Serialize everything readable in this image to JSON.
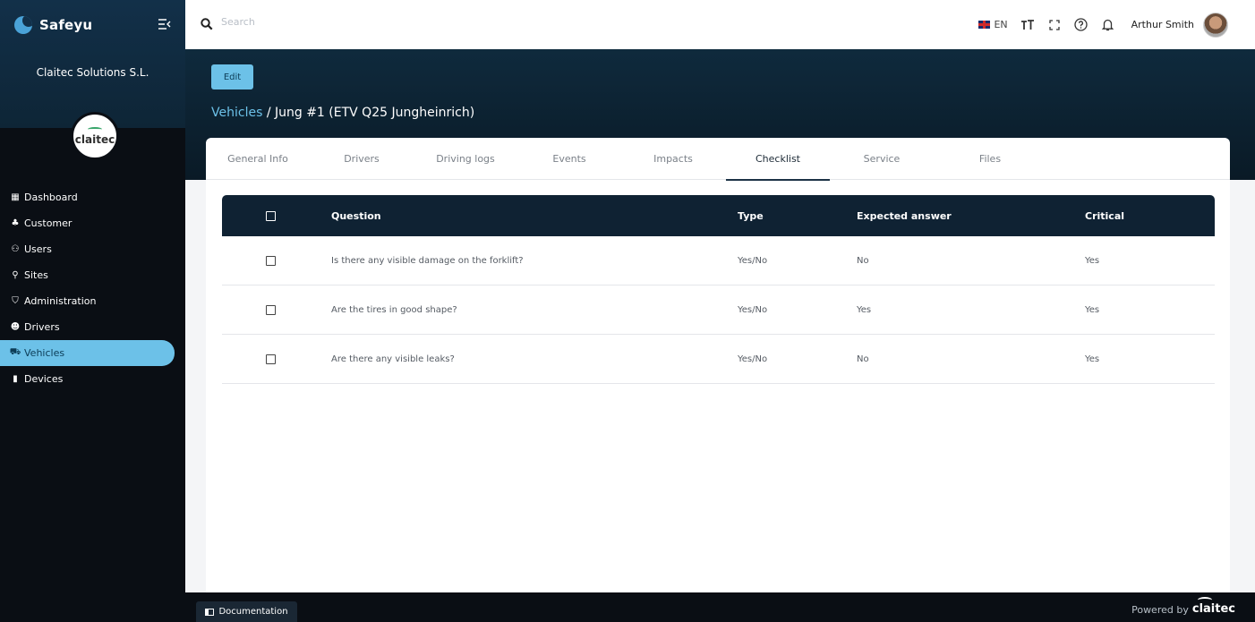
{
  "app": {
    "name": "Safeyu",
    "company": "Claitec Solutions S.L.",
    "org_logo_text": "claitec"
  },
  "nav": {
    "items": [
      {
        "label": "Dashboard",
        "icon": "dashboard-icon",
        "glyph": "▦"
      },
      {
        "label": "Customer",
        "icon": "customer-icon",
        "glyph": "♣"
      },
      {
        "label": "Users",
        "icon": "users-icon",
        "glyph": "⚇"
      },
      {
        "label": "Sites",
        "icon": "location-pin-icon",
        "glyph": "⚲"
      },
      {
        "label": "Administration",
        "icon": "shield-icon",
        "glyph": "⛉"
      },
      {
        "label": "Drivers",
        "icon": "driver-icon",
        "glyph": "☻"
      },
      {
        "label": "Vehicles",
        "icon": "forklift-icon",
        "glyph": "⛟",
        "active": true
      },
      {
        "label": "Devices",
        "icon": "device-icon",
        "glyph": "▮"
      }
    ]
  },
  "topbar": {
    "search_placeholder": "Search",
    "language": "EN",
    "user_name": "Arthur Smith"
  },
  "header": {
    "edit_label": "Edit",
    "breadcrumb_link": "Vehicles",
    "breadcrumb_current": " / Jung #1 (ETV Q25 Jungheinrich)"
  },
  "tabs": [
    {
      "label": "General Info"
    },
    {
      "label": "Drivers"
    },
    {
      "label": "Driving logs"
    },
    {
      "label": "Events"
    },
    {
      "label": "Impacts"
    },
    {
      "label": "Checklist",
      "active": true
    },
    {
      "label": "Service"
    },
    {
      "label": "Files"
    }
  ],
  "table": {
    "columns": {
      "question": "Question",
      "type": "Type",
      "expected": "Expected answer",
      "critical": "Critical"
    },
    "rows": [
      {
        "question": "Is there any visible damage on the forklift?",
        "type": "Yes/No",
        "expected": "No",
        "critical": "Yes"
      },
      {
        "question": "Are the tires in good shape?",
        "type": "Yes/No",
        "expected": "Yes",
        "critical": "Yes"
      },
      {
        "question": "Are there any visible leaks?",
        "type": "Yes/No",
        "expected": "No",
        "critical": "Yes"
      }
    ]
  },
  "footer": {
    "documentation_label": "Documentation",
    "powered_by": "Powered by",
    "powered_logo": "claitec"
  },
  "colors": {
    "accent": "#6cc1e8",
    "dark": "#0f2233"
  }
}
